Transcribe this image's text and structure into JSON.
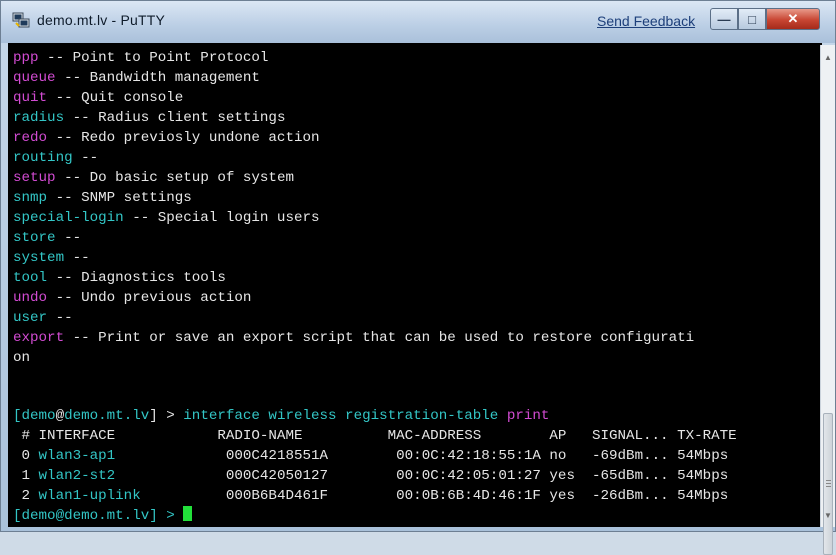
{
  "window": {
    "title": "demo.mt.lv - PuTTY",
    "send_feedback": "Send Feedback",
    "min_glyph": "—",
    "max_glyph": "□",
    "close_glyph": "✕"
  },
  "terminal": {
    "help_lines": [
      {
        "cmd": "ppp",
        "desc": " -- Point to Point Protocol",
        "color": "m"
      },
      {
        "cmd": "queue",
        "desc": " -- Bandwidth management",
        "color": "m"
      },
      {
        "cmd": "quit",
        "desc": " -- Quit console",
        "color": "m"
      },
      {
        "cmd": "radius",
        "desc": " -- Radius client settings",
        "color": "c"
      },
      {
        "cmd": "redo",
        "desc": " -- Redo previosly undone action",
        "color": "m"
      },
      {
        "cmd": "routing",
        "desc": " --",
        "color": "c"
      },
      {
        "cmd": "setup",
        "desc": " -- Do basic setup of system",
        "color": "m"
      },
      {
        "cmd": "snmp",
        "desc": " -- SNMP settings",
        "color": "c"
      },
      {
        "cmd": "special-login",
        "desc": " -- Special login users",
        "color": "c"
      },
      {
        "cmd": "store",
        "desc": " --",
        "color": "c"
      },
      {
        "cmd": "system",
        "desc": " --",
        "color": "c"
      },
      {
        "cmd": "tool",
        "desc": " -- Diagnostics tools",
        "color": "c"
      },
      {
        "cmd": "undo",
        "desc": " -- Undo previous action",
        "color": "m"
      },
      {
        "cmd": "user",
        "desc": " --",
        "color": "c"
      },
      {
        "cmd": "export",
        "desc": " -- Print or save an export script that can be used to restore configurati",
        "color": "m"
      }
    ],
    "wrap_line": "on",
    "prompt": {
      "open": "[",
      "user": "demo",
      "at": "@",
      "host": "demo.mt.lv",
      "close": "] > ",
      "command": "interface wireless registration-table",
      "verb": "print"
    },
    "table": {
      "header": " # INTERFACE            RADIO-NAME          MAC-ADDRESS        AP   SIGNAL... TX-RATE",
      "rows": [
        {
          "num": " 0",
          "iface": "wlan3-ap1",
          "radio": "000C4218551A",
          "mac": "00:0C:42:18:55:1A",
          "ap": "no",
          "signal": "-69dBm...",
          "rate": "54Mbps"
        },
        {
          "num": " 1",
          "iface": "wlan2-st2",
          "radio": "000C42050127",
          "mac": "00:0C:42:05:01:27",
          "ap": "yes",
          "signal": "-65dBm...",
          "rate": "54Mbps"
        },
        {
          "num": " 2",
          "iface": "wlan1-uplink",
          "radio": "000B6B4D461F",
          "mac": "00:0B:6B:4D:46:1F",
          "ap": "yes",
          "signal": "-26dBm...",
          "rate": "54Mbps"
        }
      ]
    },
    "final_prompt": "[demo@demo.mt.lv] > "
  }
}
